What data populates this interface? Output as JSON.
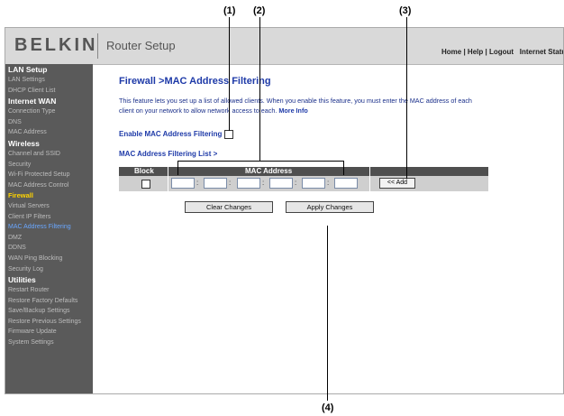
{
  "callouts": {
    "c1": "(1)",
    "c2": "(2)",
    "c3": "(3)",
    "c4": "(4)"
  },
  "header": {
    "logo": "BELKIN",
    "title": "Router Setup",
    "links": {
      "home": "Home",
      "sep1": " | ",
      "help": "Help",
      "sep2": " | ",
      "logout": "Logout",
      "status": "Internet Status"
    }
  },
  "sidebar": {
    "sections": [
      {
        "heading": "LAN Setup",
        "items": [
          "LAN Settings",
          "DHCP Client List"
        ]
      },
      {
        "heading": "Internet WAN",
        "items": [
          "Connection Type",
          "DNS",
          "MAC Address"
        ]
      },
      {
        "heading": "Wireless",
        "items": [
          "Channel and SSID",
          "Security",
          "Wi-Fi Protected Setup",
          "MAC Address Control"
        ]
      },
      {
        "heading": "Firewall",
        "items": [
          "Virtual Servers",
          "Client IP Filters",
          "MAC Address Filtering",
          "DMZ",
          "DDNS",
          "WAN Ping Blocking",
          "Security Log"
        ]
      },
      {
        "heading": "Utilities",
        "items": [
          "Restart Router",
          "Restore Factory Defaults",
          "Save/Backup Settings",
          "Restore Previous Settings",
          "Firmware Update",
          "System Settings"
        ]
      }
    ]
  },
  "main": {
    "title": "Firewall >MAC Address Filtering",
    "description": "This feature lets you set up a list of allowed clients. When you enable this feature, you must enter the MAC address of each client on your network to allow network access to each.",
    "more_info": "More Info",
    "enable_label": "Enable MAC Address Filtering",
    "list_header": "MAC Address Filtering List >",
    "table": {
      "col_block": "Block",
      "col_mac": "MAC Address",
      "colon": ":"
    },
    "add_label": "<< Add",
    "clear_label": "Clear Changes",
    "apply_label": "Apply Changes"
  }
}
